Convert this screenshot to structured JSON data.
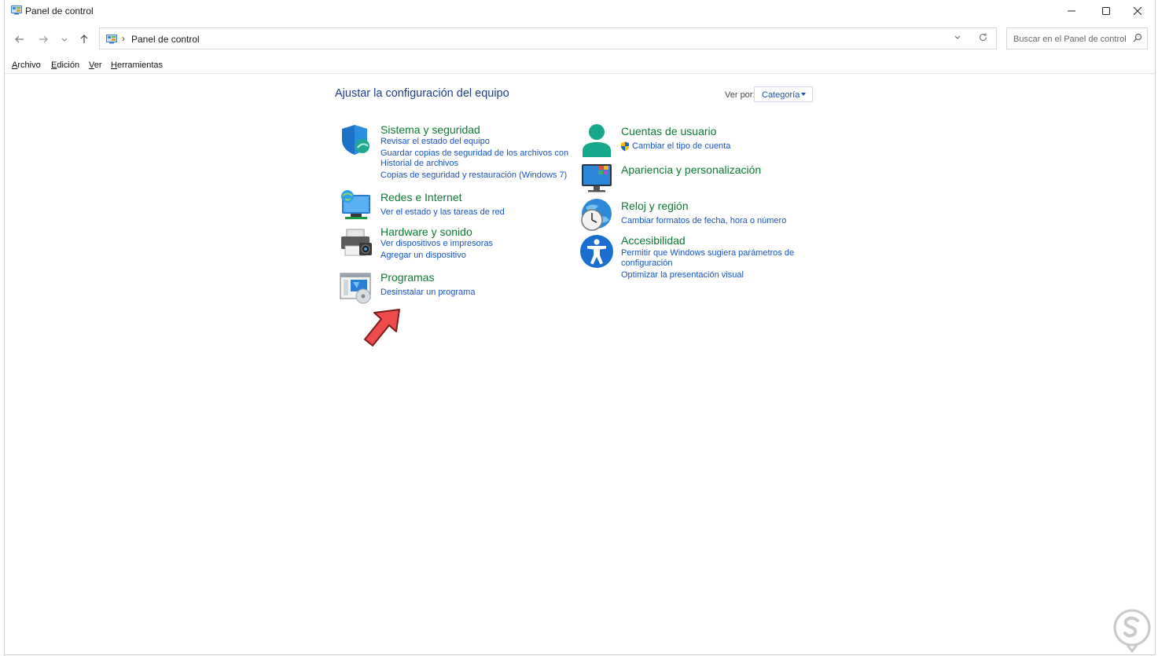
{
  "window": {
    "title": "Panel de control",
    "minimize_icon": "minimize-icon",
    "maximize_icon": "maximize-icon",
    "close_icon": "close-icon"
  },
  "address": {
    "breadcrumb": "Panel de control",
    "search_placeholder": "Buscar en el Panel de control"
  },
  "menu": [
    "Archivo",
    "Edición",
    "Ver",
    "Herramientas"
  ],
  "main": {
    "heading": "Ajustar la configuración del equipo",
    "view_by_label": "Ver por:",
    "view_by_value": "Categoría"
  },
  "categories": {
    "sistema": {
      "title": "Sistema y seguridad",
      "links": [
        "Revisar el estado del equipo",
        "Guardar copias de seguridad de los archivos con",
        "Historial de archivos",
        "Copias de seguridad y restauración (Windows 7)"
      ]
    },
    "redes": {
      "title": "Redes e Internet",
      "links": [
        "Ver el estado y las tareas de red"
      ]
    },
    "hardware": {
      "title": "Hardware y sonido",
      "links": [
        "Ver dispositivos e impresoras",
        "Agregar un dispositivo"
      ]
    },
    "programas": {
      "title": "Programas",
      "links": [
        "Desinstalar un programa"
      ]
    },
    "cuentas": {
      "title": "Cuentas de usuario",
      "links": [
        "Cambiar el tipo de cuenta"
      ]
    },
    "apariencia": {
      "title": "Apariencia y personalización",
      "links": []
    },
    "reloj": {
      "title": "Reloj y región",
      "links": [
        "Cambiar formatos de fecha, hora o número"
      ]
    },
    "accesibilidad": {
      "title": "Accesibilidad",
      "links": [
        "Permitir que Windows sugiera parámetros de",
        "configuración",
        "Optimizar la presentación visual"
      ]
    }
  },
  "colors": {
    "heading_green": "#0d7a35",
    "link_blue": "#1a54c4",
    "title_blue": "#1e3c8c",
    "annotation_arrow": "#ee4b4b"
  }
}
